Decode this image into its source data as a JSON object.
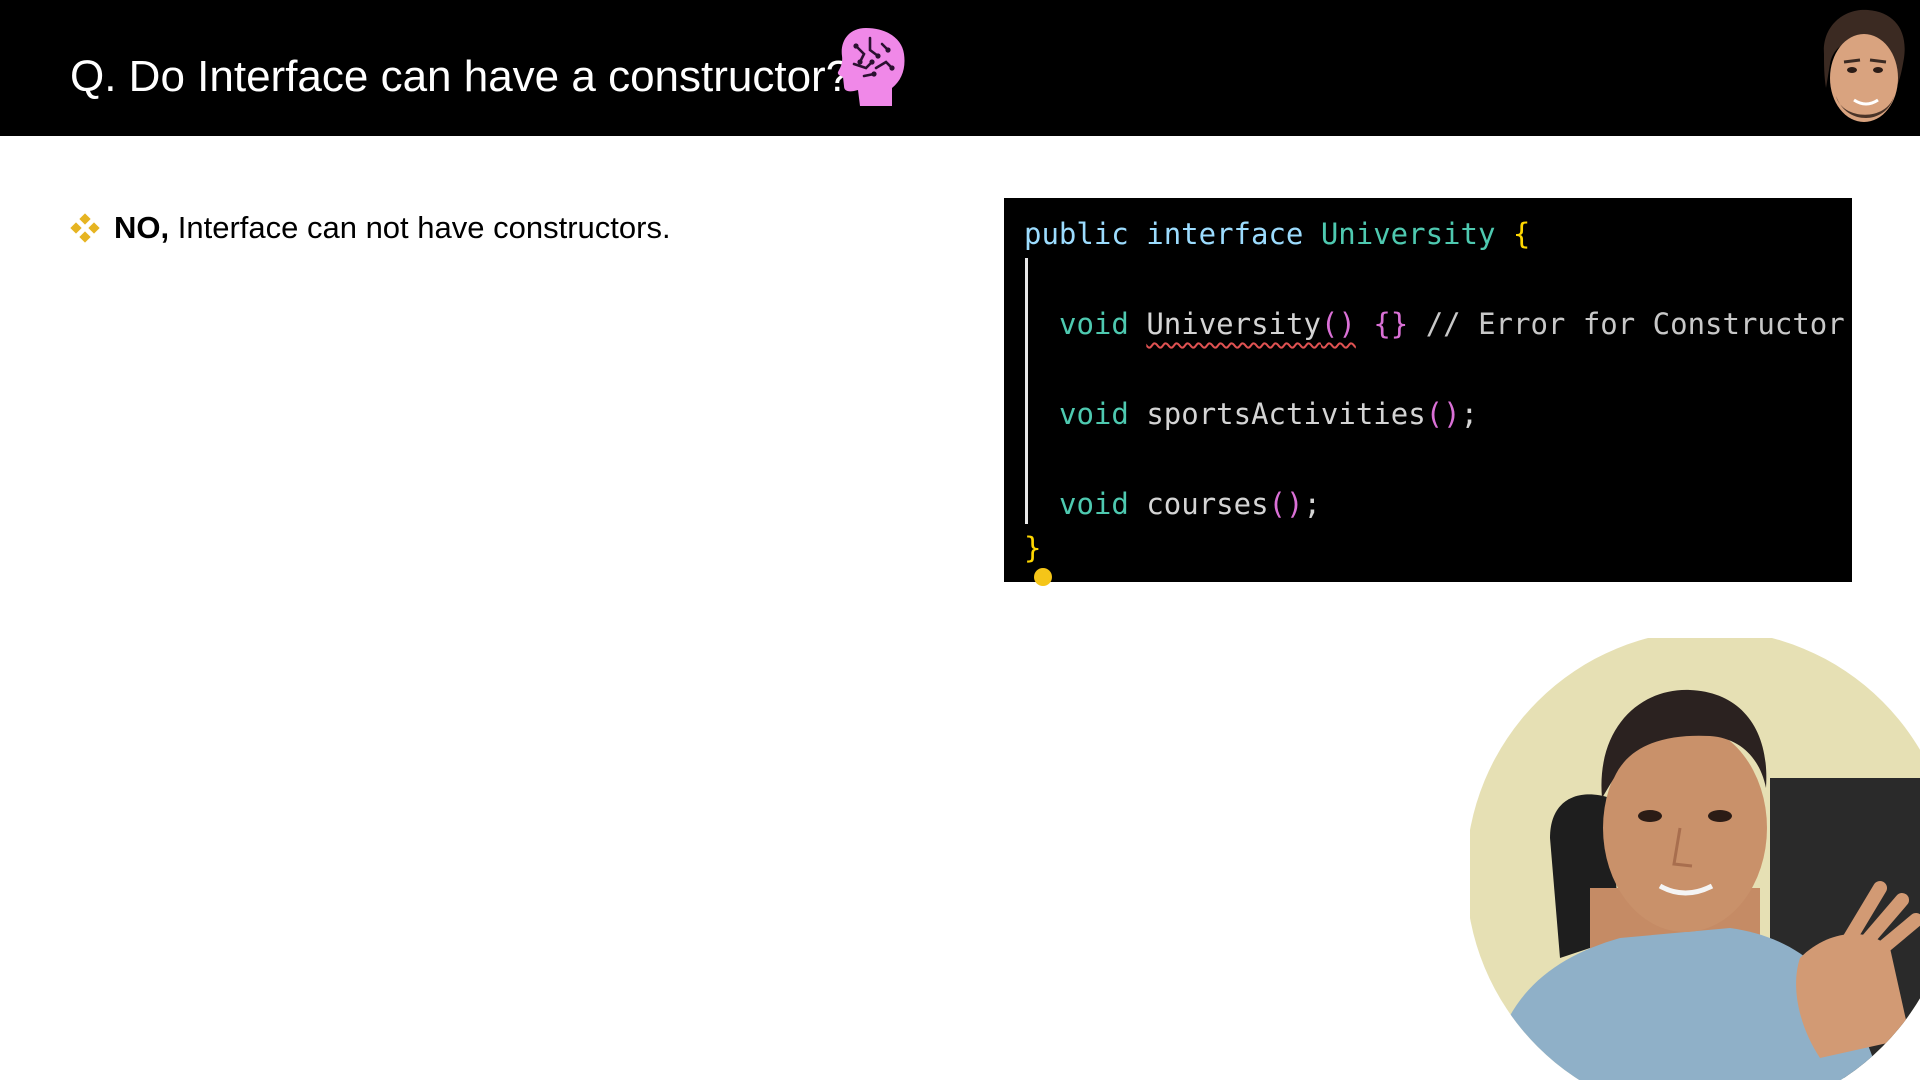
{
  "header": {
    "title": "Q. Do Interface can have a constructor?",
    "brain_icon": "brain-head-icon",
    "thumbnail": "presenter-avatar"
  },
  "bullet": {
    "icon": "diamond-bullet-icon",
    "bold": "NO,",
    "text": " Interface can not have constructors."
  },
  "code": {
    "line1": {
      "kw_public": "public",
      "kw_interface": "interface",
      "name": "University",
      "brace": "{"
    },
    "line2": {
      "kw_void": "void",
      "name": "University",
      "parens": "()",
      "braces": "{}",
      "comment": "// Error for Constructor"
    },
    "line3": {
      "kw_void": "void",
      "name": "sportsActivities",
      "parens": "()",
      "semi": ";"
    },
    "line4": {
      "kw_void": "void",
      "name": "courses",
      "parens": "()",
      "semi": ";"
    },
    "line5": {
      "brace": "}"
    }
  },
  "colors": {
    "header_bg": "#000000",
    "brain_pink": "#f088e8",
    "bullet_gold": "#e6b422",
    "code_bg": "#000000",
    "squiggle_red": "#e05252"
  }
}
